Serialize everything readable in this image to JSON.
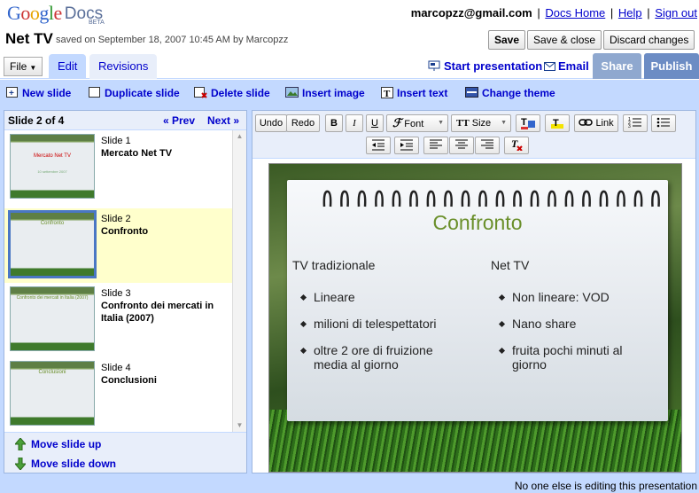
{
  "logo": {
    "google": "Google",
    "docs": "Docs",
    "beta": "BETA"
  },
  "user": {
    "email": "marcopzz@gmail.com",
    "links": [
      "Docs Home",
      "Help",
      "Sign out"
    ]
  },
  "document": {
    "title": "Net TV",
    "saved_status": "saved on September 18, 2007 10:45 AM by Marcopzz"
  },
  "header_buttons": {
    "save": "Save",
    "save_close": "Save & close",
    "discard": "Discard changes"
  },
  "menu": {
    "file": "File"
  },
  "tabs": {
    "edit": "Edit",
    "revisions": "Revisions",
    "share": "Share",
    "publish": "Publish"
  },
  "presentation_links": {
    "start": "Start presentation",
    "email": "Email"
  },
  "actions": {
    "new_slide": "New slide",
    "duplicate_slide": "Duplicate slide",
    "delete_slide": "Delete slide",
    "insert_image": "Insert image",
    "insert_text": "Insert text",
    "change_theme": "Change theme"
  },
  "slide_nav": {
    "count": "Slide 2 of 4",
    "prev": "« Prev",
    "next": "Next »"
  },
  "slides": [
    {
      "num": "Slide 1",
      "name": "Mercato Net TV",
      "thumb_title": "Mercato Net TV",
      "thumb_sub": "10 settembre 2007"
    },
    {
      "num": "Slide 2",
      "name": "Confronto",
      "thumb_title": "Confronto",
      "thumb_sub": ""
    },
    {
      "num": "Slide 3",
      "name": "Confronto dei mercati in Italia (2007)",
      "thumb_title": "Confronto dei mercati in Italia (2007)",
      "thumb_sub": ""
    },
    {
      "num": "Slide 4",
      "name": "Conclusioni",
      "thumb_title": "Conclusioni",
      "thumb_sub": ""
    }
  ],
  "move": {
    "up": "Move slide up",
    "down": "Move slide down"
  },
  "toolbar": {
    "undo": "Undo",
    "redo": "Redo",
    "bold": "B",
    "italic": "I",
    "underline": "U",
    "font": "Font",
    "size": "Size",
    "link": "Link"
  },
  "current_slide": {
    "title": "Confronto",
    "left_heading": "TV tradizionale",
    "left_bullets": [
      "Lineare",
      "milioni di telespettatori",
      "oltre 2 ore di fruizione media al giorno"
    ],
    "right_heading": "Net TV",
    "right_bullets": [
      "Non lineare: VOD",
      "Nano share",
      "fruita pochi minuti al giorno"
    ]
  },
  "status": "No one else is editing this presentation",
  "colors": {
    "accent_blue": "#c3d9ff",
    "link": "#0000cc",
    "slide_title_green": "#6a8f2a",
    "selected_row": "#ffffcc"
  }
}
